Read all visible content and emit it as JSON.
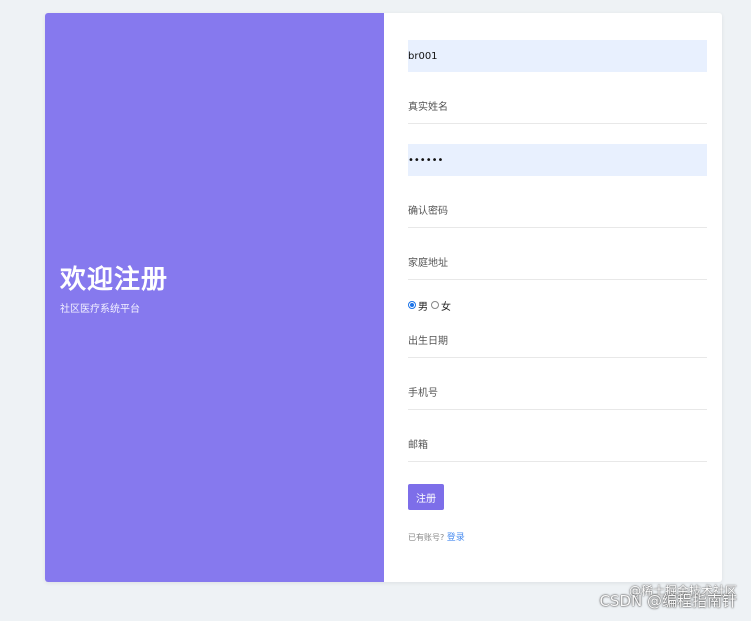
{
  "left": {
    "title": "欢迎注册",
    "subtitle": "社区医疗系统平台"
  },
  "form": {
    "username_value": "br001",
    "realname_placeholder": "真实姓名",
    "password_value": "••••••",
    "confirm_placeholder": "确认密码",
    "address_placeholder": "家庭地址",
    "gender": {
      "options": [
        "男",
        "女"
      ],
      "selected": "男"
    },
    "birth_placeholder": "出生日期",
    "phone_placeholder": "手机号",
    "email_placeholder": "邮箱",
    "submit_label": "注册",
    "has_account_text": "已有账号?",
    "login_link": "登录"
  },
  "watermark": {
    "line1": "@稀土掘金技术社区",
    "line2": "CSDN @编程指南针"
  },
  "colors": {
    "accent": "#8679ee",
    "button": "#7d6ee9",
    "link": "#4a8df0",
    "filled_bg": "#e8f0fe"
  }
}
